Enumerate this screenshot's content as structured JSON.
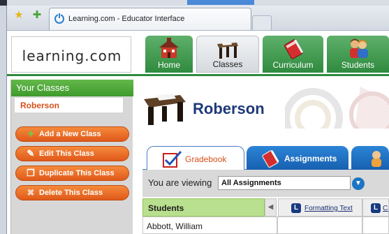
{
  "browser": {
    "tab_title": "Learning.com - Educator Interface"
  },
  "header": {
    "logo": "learning.com",
    "nav": [
      {
        "label": "Home",
        "icon": "schoolhouse-icon"
      },
      {
        "label": "Classes",
        "icon": "desk-icon",
        "selected": true
      },
      {
        "label": "Curriculum",
        "icon": "book-icon"
      },
      {
        "label": "Students",
        "icon": "students-icon"
      }
    ]
  },
  "sidebar": {
    "heading": "Your Classes",
    "class_item": "Roberson",
    "buttons": {
      "add": "Add a New Class",
      "edit": "Edit This Class",
      "duplicate": "Duplicate This Class",
      "delete": "Delete This Class"
    }
  },
  "main": {
    "class_name": "Roberson",
    "tabs": {
      "gradebook": "Gradebook",
      "assignments": "Assignments"
    },
    "viewing_label": "You are viewing",
    "viewing_value": "All Assignments",
    "table": {
      "students_header": "Students",
      "columns": [
        {
          "badge": "L",
          "label": "Formatting Text"
        },
        {
          "badge": "L",
          "label": "Cr"
        }
      ],
      "rows": [
        {
          "student": "Abbott, William"
        }
      ]
    }
  },
  "colors": {
    "nav_green": "#2f8a3e",
    "button_orange": "#e0591a",
    "tab_blue": "#1760b0",
    "class_title": "#1e3a7a",
    "students_header_bg": "#b8e08e"
  }
}
